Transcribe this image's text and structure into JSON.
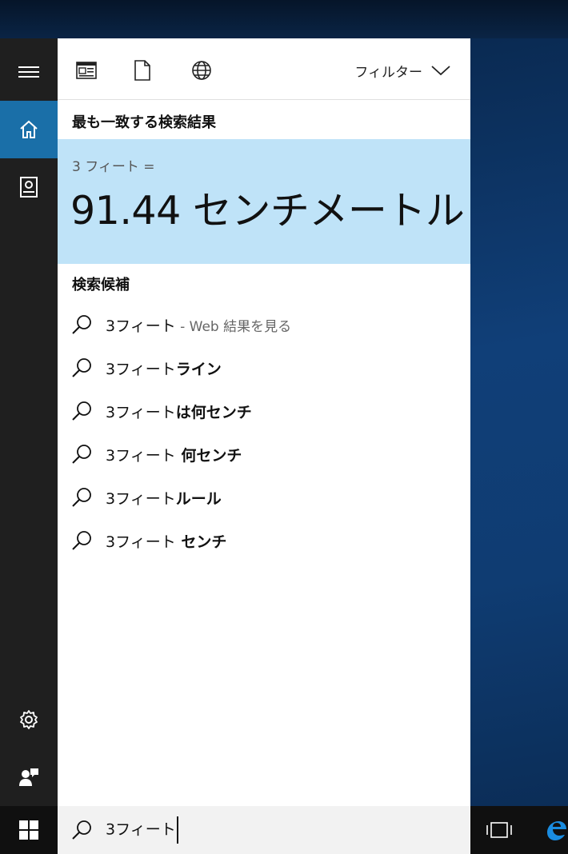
{
  "toolbar": {
    "icons": [
      "news-icon",
      "document-icon",
      "globe-icon"
    ],
    "filter_label": "フィルター"
  },
  "best_match": {
    "section_title": "最も一致する検索結果",
    "query": "3 フィート =",
    "answer": "91.44 センチメートル",
    "bg_color": "#bfe3f8"
  },
  "suggestions": {
    "section_title": "検索候補",
    "items": [
      {
        "prefix": "3フィート",
        "suffix": "",
        "hint": " - Web 結果を見る"
      },
      {
        "prefix": "3フィート",
        "suffix": "ライン",
        "hint": ""
      },
      {
        "prefix": "3フィート",
        "suffix": "は何センチ",
        "hint": ""
      },
      {
        "prefix": "3フィート",
        "suffix": " 何センチ",
        "hint": ""
      },
      {
        "prefix": "3フィート",
        "suffix": "ルール",
        "hint": ""
      },
      {
        "prefix": "3フィート",
        "suffix": " センチ",
        "hint": ""
      }
    ]
  },
  "search": {
    "value": "3フィート"
  },
  "colors": {
    "accent": "#1a6fa8",
    "rail": "#1f1f1f",
    "taskbar": "#101010"
  }
}
